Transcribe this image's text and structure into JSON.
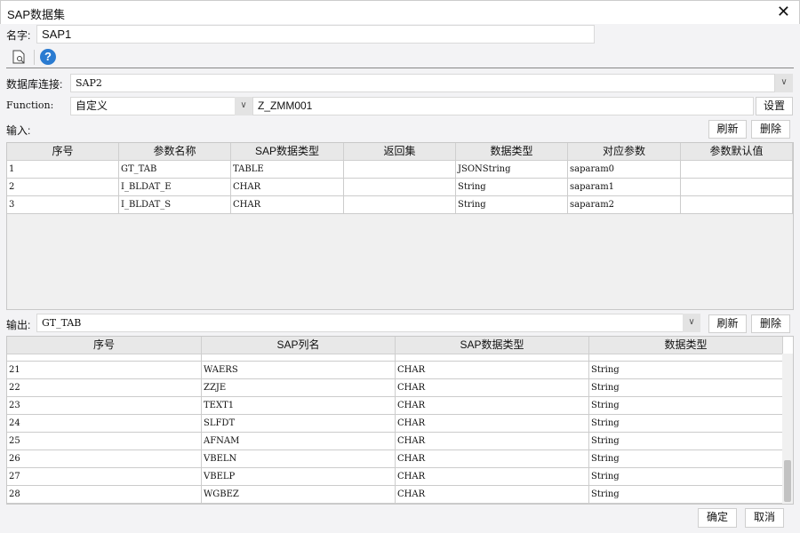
{
  "window": {
    "title": "SAP数据集",
    "close": "✕"
  },
  "name": {
    "label": "名字:",
    "value": "SAP1"
  },
  "toolbar": {
    "preview_icon": "document-preview-icon",
    "help_icon": "help-icon"
  },
  "db": {
    "label": "数据库连接:",
    "value": "SAP2"
  },
  "function": {
    "label": "Function:",
    "mode": "自定义",
    "value": "Z_ZMM001",
    "settings": "设置"
  },
  "input": {
    "label": "输入:",
    "refresh": "刷新",
    "delete": "删除",
    "columns": [
      "序号",
      "参数名称",
      "SAP数据类型",
      "返回集",
      "数据类型",
      "对应参数",
      "参数默认值"
    ],
    "rows": [
      [
        "1",
        "GT_TAB",
        "TABLE",
        "",
        "JSONString",
        "saparam0",
        ""
      ],
      [
        "2",
        "I_BLDAT_E",
        "CHAR",
        "",
        "String",
        "saparam1",
        ""
      ],
      [
        "3",
        "I_BLDAT_S",
        "CHAR",
        "",
        "String",
        "saparam2",
        ""
      ]
    ]
  },
  "output": {
    "label": "输出:",
    "value": "GT_TAB",
    "refresh": "刷新",
    "delete": "删除",
    "columns": [
      "序号",
      "SAP列名",
      "SAP数据类型",
      "数据类型"
    ],
    "rows": [
      [
        "21",
        "WAERS",
        "CHAR",
        "String"
      ],
      [
        "22",
        "ZZJE",
        "CHAR",
        "String"
      ],
      [
        "23",
        "TEXT1",
        "CHAR",
        "String"
      ],
      [
        "24",
        "SLFDT",
        "CHAR",
        "String"
      ],
      [
        "25",
        "AFNAM",
        "CHAR",
        "String"
      ],
      [
        "26",
        "VBELN",
        "CHAR",
        "String"
      ],
      [
        "27",
        "VBELP",
        "CHAR",
        "String"
      ],
      [
        "28",
        "WGBEZ",
        "CHAR",
        "String"
      ]
    ]
  },
  "footer": {
    "ok": "确定",
    "cancel": "取消"
  }
}
